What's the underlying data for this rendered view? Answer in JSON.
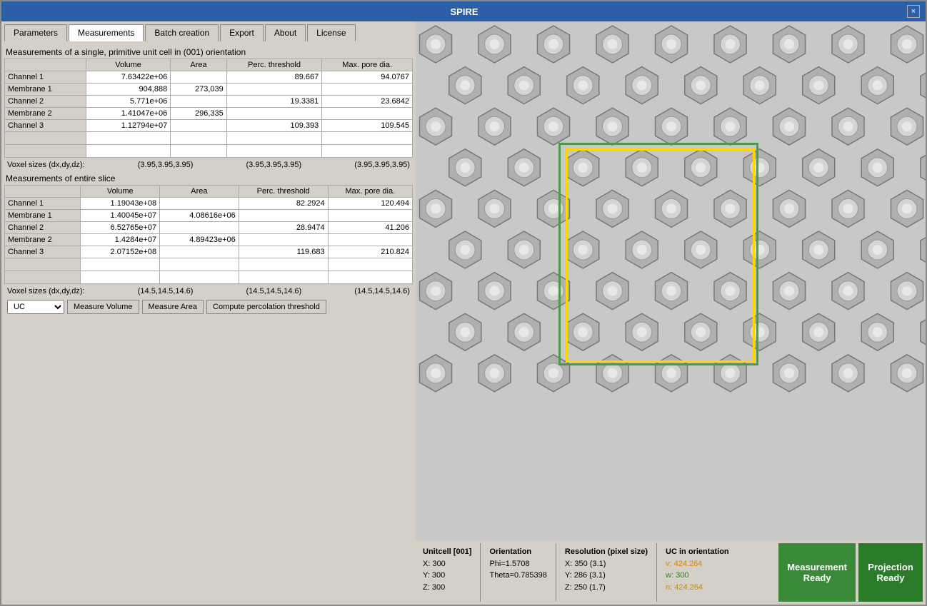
{
  "window": {
    "title": "SPIRE",
    "close_label": "×"
  },
  "tabs": [
    {
      "id": "parameters",
      "label": "Parameters",
      "active": false
    },
    {
      "id": "measurements",
      "label": "Measurements",
      "active": true
    },
    {
      "id": "batch_creation",
      "label": "Batch creation",
      "active": false
    },
    {
      "id": "export",
      "label": "Export",
      "active": false
    },
    {
      "id": "about",
      "label": "About",
      "active": false
    },
    {
      "id": "license",
      "label": "License",
      "active": false
    }
  ],
  "section1": {
    "label": "Measurements of a single, primitive unit cell in (001) orientation",
    "columns": [
      "",
      "Volume",
      "Area",
      "Perc. threshold",
      "Max. pore dia."
    ],
    "rows": [
      {
        "name": "Channel 1",
        "volume": "7.63422e+06",
        "area": "",
        "perc_threshold": "89.667",
        "max_pore_dia": "94.0767"
      },
      {
        "name": "Membrane 1",
        "volume": "904,888",
        "area": "273,039",
        "perc_threshold": "",
        "max_pore_dia": ""
      },
      {
        "name": "Channel 2",
        "volume": "5.771e+06",
        "area": "",
        "perc_threshold": "19.3381",
        "max_pore_dia": "23.6842"
      },
      {
        "name": "Membrane 2",
        "volume": "1.41047e+06",
        "area": "296,335",
        "perc_threshold": "",
        "max_pore_dia": ""
      },
      {
        "name": "Channel 3",
        "volume": "1.12794e+07",
        "area": "",
        "perc_threshold": "109.393",
        "max_pore_dia": "109.545"
      }
    ]
  },
  "voxel1": {
    "label": "Voxel sizes (dx,dy,dz):",
    "values": [
      "(3.95,3.95,3.95)",
      "(3.95,3.95,3.95)",
      "(3.95,3.95,3.95)"
    ]
  },
  "section2": {
    "label": "Measurements of entire slice",
    "columns": [
      "",
      "Volume",
      "Area",
      "Perc. threshold",
      "Max. pore dia."
    ],
    "rows": [
      {
        "name": "Channel 1",
        "volume": "1.19043e+08",
        "area": "",
        "perc_threshold": "82.2924",
        "max_pore_dia": "120.494"
      },
      {
        "name": "Membrane 1",
        "volume": "1.40045e+07",
        "area": "4.08616e+06",
        "perc_threshold": "",
        "max_pore_dia": ""
      },
      {
        "name": "Channel 2",
        "volume": "6.52765e+07",
        "area": "",
        "perc_threshold": "28.9474",
        "max_pore_dia": "41.206"
      },
      {
        "name": "Membrane 2",
        "volume": "1.4284e+07",
        "area": "4.89423e+06",
        "perc_threshold": "",
        "max_pore_dia": ""
      },
      {
        "name": "Channel 3",
        "volume": "2.07152e+08",
        "area": "",
        "perc_threshold": "119.683",
        "max_pore_dia": "210.824"
      }
    ]
  },
  "voxel2": {
    "label": "Voxel sizes (dx,dy,dz):",
    "values": [
      "(14.5,14.5,14.6)",
      "(14.5,14.5,14.6)",
      "(14.5,14.5,14.6)"
    ]
  },
  "bottom_controls": {
    "select_label": "UC",
    "select_options": [
      "UC"
    ],
    "buttons": [
      {
        "id": "measure_volume",
        "label": "Measure Volume"
      },
      {
        "id": "measure_area",
        "label": "Measure Area"
      },
      {
        "id": "compute_percolation",
        "label": "Compute percolation threshold"
      }
    ]
  },
  "status": {
    "unitcell_label": "Unitcell [001]",
    "unitcell_x": "X: 300",
    "unitcell_y": "Y: 300",
    "unitcell_z": "Z: 300",
    "orientation_label": "Orientation",
    "phi": "Phi=1.5708",
    "theta": "Theta=0.785398",
    "resolution_label": "Resolution (pixel size)",
    "res_x": "X:  350 (3.1)",
    "res_y": "Y:  286 (3.1)",
    "res_z": "Z:  250 (1.7)",
    "uc_orientation_label": "UC in orientation",
    "uc_v": "v: 424.264",
    "uc_w": "w: 300",
    "uc_n": "n: 424.264",
    "ready_label": "Measurement\nReady",
    "projection_label": "Projection\nReady"
  }
}
